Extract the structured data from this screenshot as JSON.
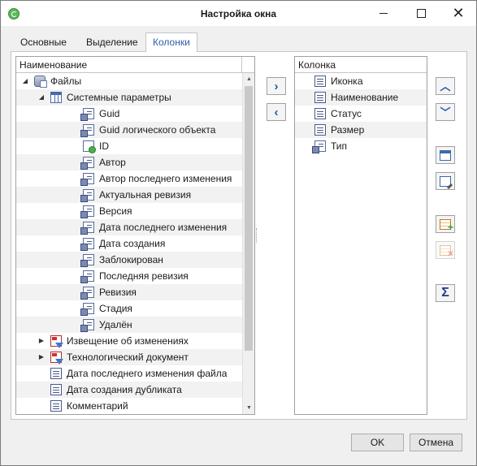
{
  "window": {
    "title": "Настройка окна"
  },
  "tabs": [
    {
      "label": "Основные"
    },
    {
      "label": "Выделение"
    },
    {
      "label": "Колонки",
      "active": true
    }
  ],
  "left_grid": {
    "header": "Наименование",
    "rows": [
      {
        "label": "Файлы",
        "icon": "database-icon",
        "level": 0,
        "expander": "expanded"
      },
      {
        "label": "Системные параметры",
        "icon": "table-icon",
        "level": 1,
        "expander": "expanded"
      },
      {
        "label": "Guid",
        "icon": "property-icon",
        "level": 2
      },
      {
        "label": "Guid логического объекта",
        "icon": "property-icon",
        "level": 2
      },
      {
        "label": "ID",
        "icon": "id-property-icon",
        "level": 2
      },
      {
        "label": "Автор",
        "icon": "property-icon",
        "level": 2
      },
      {
        "label": "Автор последнего изменения",
        "icon": "property-icon",
        "level": 2
      },
      {
        "label": "Актуальная ревизия",
        "icon": "property-icon",
        "level": 2
      },
      {
        "label": "Версия",
        "icon": "property-icon",
        "level": 2
      },
      {
        "label": "Дата последнего изменения",
        "icon": "property-icon",
        "level": 2
      },
      {
        "label": "Дата создания",
        "icon": "property-icon",
        "level": 2
      },
      {
        "label": "Заблокирован",
        "icon": "property-icon",
        "level": 2
      },
      {
        "label": "Последняя ревизия",
        "icon": "property-icon",
        "level": 2
      },
      {
        "label": "Ревизия",
        "icon": "property-icon",
        "level": 2
      },
      {
        "label": "Стадия",
        "icon": "property-icon",
        "level": 2
      },
      {
        "label": "Удалён",
        "icon": "property-icon",
        "level": 2
      },
      {
        "label": "Извещение об изменениях",
        "icon": "document-type-icon",
        "level": 1,
        "expander": "collapsed"
      },
      {
        "label": "Технологический документ",
        "icon": "document-type-icon",
        "level": 1,
        "expander": "collapsed"
      },
      {
        "label": "Дата последнего изменения файла",
        "icon": "document-icon",
        "level": 1
      },
      {
        "label": "Дата создания дубликата",
        "icon": "document-icon",
        "level": 1
      },
      {
        "label": "Комментарий",
        "icon": "document-icon",
        "level": 1
      }
    ]
  },
  "move_buttons": {
    "add": "›",
    "remove": "‹"
  },
  "right_grid": {
    "header": "Колонка",
    "rows": [
      {
        "label": "Иконка",
        "icon": "document-icon"
      },
      {
        "label": "Наименование",
        "icon": "document-icon"
      },
      {
        "label": "Статус",
        "icon": "document-icon"
      },
      {
        "label": "Размер",
        "icon": "document-icon"
      },
      {
        "label": "Тип",
        "icon": "property-icon"
      }
    ]
  },
  "side_buttons": {
    "sum": "Σ"
  },
  "footer": {
    "ok": "OK",
    "cancel": "Отмена"
  }
}
